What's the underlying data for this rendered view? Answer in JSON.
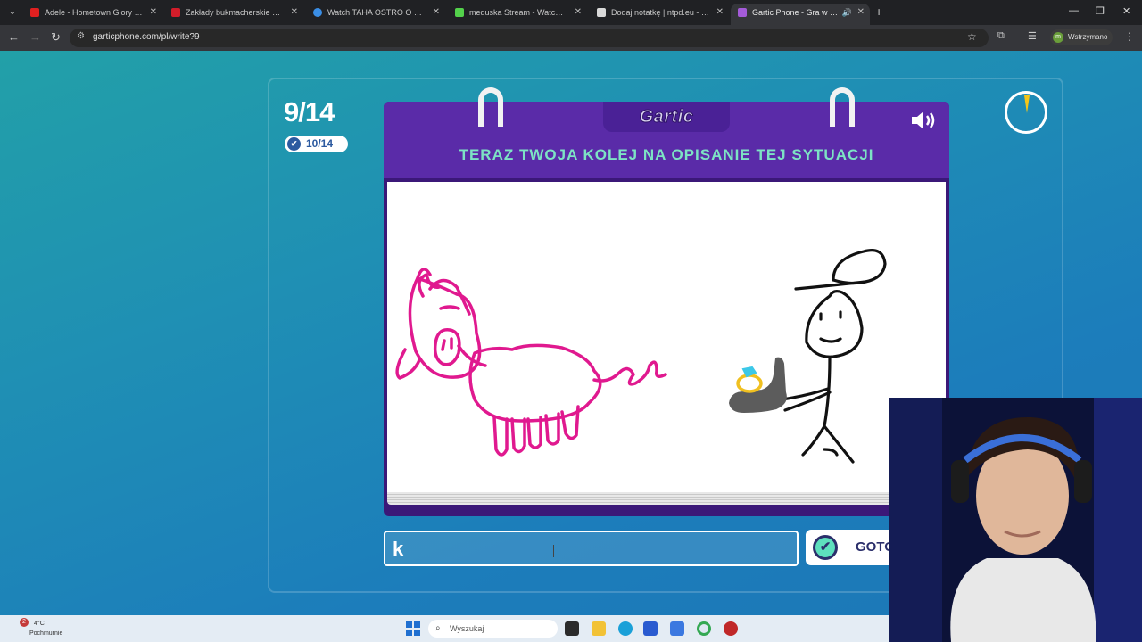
{
  "browser": {
    "tabs": [
      {
        "title": "Adele - Hometown Glory (Offic",
        "favicon_color": "#e02020"
      },
      {
        "title": "Zakłady bukmacherskie Betclic",
        "favicon_color": "#d21d2a"
      },
      {
        "title": "Watch TAHA OSTRO O PAJALO",
        "favicon_color": "#3a8ee6"
      },
      {
        "title": "meduska Stream - Watch Live o",
        "favicon_color": "#53d14b"
      },
      {
        "title": "Dodaj notatkę | ntpd.eu - notat",
        "favicon_color": "#d9d9d9"
      },
      {
        "title": "Gartic Phone - Gra w głuch",
        "favicon_color": "#a45bd9",
        "active": true
      }
    ],
    "url": "garticphone.com/pl/write?9",
    "profile_status": "Wstrzymano",
    "profile_initial": "m"
  },
  "game": {
    "round": "9/14",
    "done_count": "10/14",
    "logo": "Gartic",
    "instruction": "TERAZ TWOJA KOLEJ NA OPISANIE TEJ SYTUACJI",
    "answer_value": "k",
    "ready_label": "GOTO"
  },
  "taskbar": {
    "notification_count": "2",
    "temperature": "4°C",
    "weather": "Pochmurnie",
    "search_placeholder": "Wyszukaj"
  },
  "colors": {
    "accent_purple": "#5a2ba8",
    "instruction_green": "#7de3c4",
    "pig_stroke": "#e0198f",
    "ring_gold": "#f0c020",
    "ring_gem": "#3cc8e8"
  }
}
